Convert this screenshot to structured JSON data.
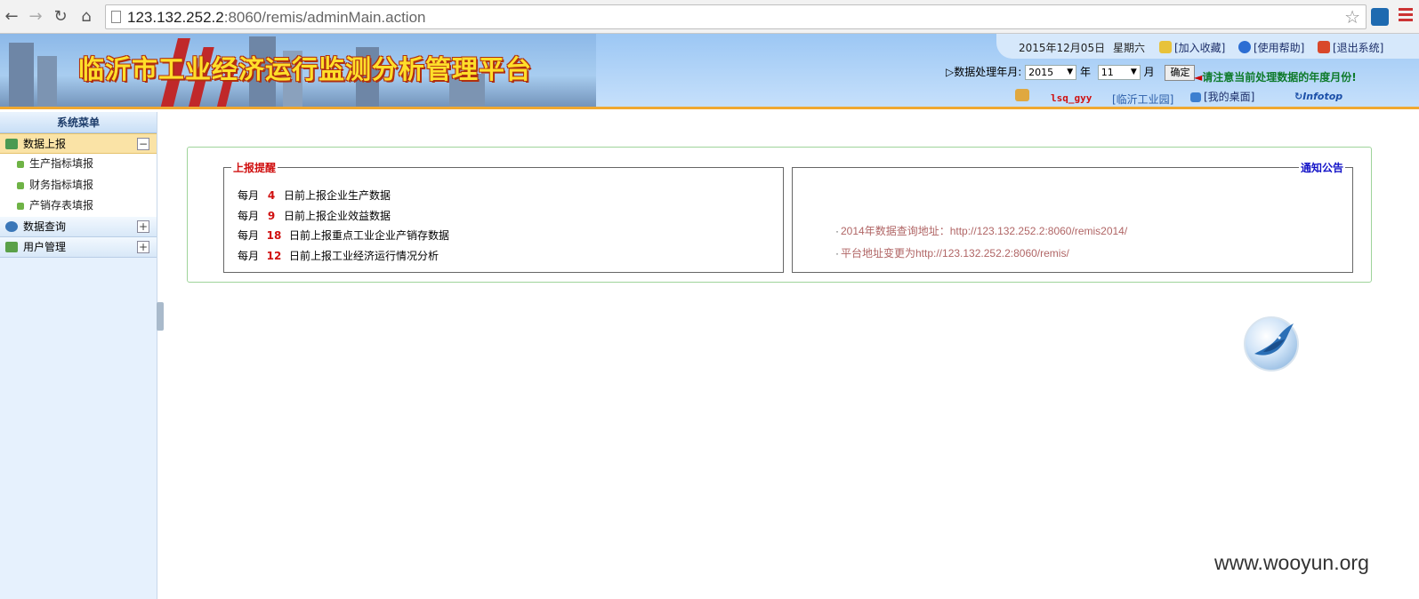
{
  "browser": {
    "url_host": "123.132.252.2",
    "url_rest": ":8060/remis/adminMain.action",
    "back_icon": "back-arrow-icon",
    "forward_icon": "forward-arrow-icon",
    "reload_icon": "reload-icon",
    "home_icon": "home-icon"
  },
  "header": {
    "title": "临沂市工业经济运行监测分析管理平台",
    "date": "2015年12月05日",
    "weekday": "星期六",
    "favorite": "[加入收藏]",
    "help": "[使用帮助]",
    "logout": "[退出系统]",
    "period_label": "▷数据处理年月:",
    "year_value": "2015",
    "year_suffix": "年",
    "month_value": "11",
    "month_suffix": "月",
    "confirm_label": "确定",
    "notice_text": "请注意当前处理数据的年度月份!",
    "user_name": "lsq_gyy",
    "park_link": "[临沂工业园]",
    "desktop_link": "[我的桌面]",
    "brand": "Infotop"
  },
  "sidebar": {
    "title": "系统菜单",
    "groups": [
      {
        "label": "数据上报",
        "toggle": "−",
        "active": true
      },
      {
        "label": "数据查询",
        "toggle": "+"
      },
      {
        "label": "用户管理",
        "toggle": "+"
      }
    ],
    "sub_items": [
      "生产指标填报",
      "财务指标填报",
      "产销存表填报"
    ]
  },
  "reminder": {
    "title": "上报提醒",
    "rows": [
      {
        "prefix": "每月",
        "day": "4",
        "text": "日前上报企业生产数据"
      },
      {
        "prefix": "每月",
        "day": "9",
        "text": "日前上报企业效益数据"
      },
      {
        "prefix": "每月",
        "day": "18",
        "text": "日前上报重点工业企业产销存数据"
      },
      {
        "prefix": "每月",
        "day": "12",
        "text": "日前上报工业经济运行情况分析"
      }
    ]
  },
  "announcements": {
    "title": "通知公告",
    "items": [
      "2014年数据查询地址：http://123.132.252.2:8060/remis2014/",
      "平台地址变更为http://123.132.252.2:8060/remis/"
    ]
  },
  "colors": {
    "header_title": "#ffdf2a",
    "reminder_title": "#d01010",
    "announce_title": "#1515c8",
    "notice": "#0d7a2a"
  },
  "watermark": "www.wooyun.org"
}
